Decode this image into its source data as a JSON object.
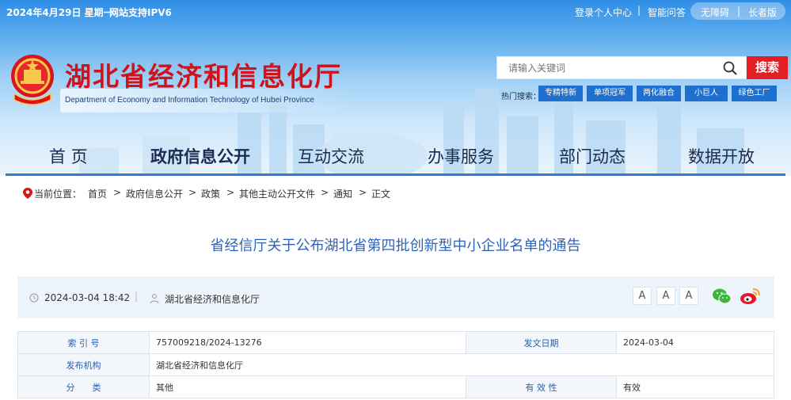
{
  "topbar": {
    "date": "2024年4月29日 星期一",
    "ipv6": "网站支持IPV6",
    "login": "登录个人中心",
    "separator": "|",
    "qa": "智能问答",
    "accessibility": "无障碍",
    "pill_separator": "|",
    "elderly": "长者版"
  },
  "site": {
    "title": "湖北省经济和信息化厅",
    "subtitle_en": "Department of Economy and Information Technology of Hubei Province"
  },
  "search": {
    "placeholder": "请输入关键词",
    "button": "搜索",
    "hot_label": "热门搜索：",
    "hot_tags": [
      "专精特新",
      "单项冠军",
      "两化融合",
      "小巨人",
      "绿色工厂"
    ]
  },
  "nav": {
    "items": [
      "首 页",
      "政府信息公开",
      "互动交流",
      "办事服务",
      "部门动态",
      "数据开放"
    ],
    "active_index": 1
  },
  "breadcrumb": {
    "label": "当前位置：",
    "items": [
      "首页",
      "政府信息公开",
      "政策",
      "其他主动公开文件",
      "通知",
      "正文"
    ],
    "sep": ">"
  },
  "article": {
    "title": "省经信厅关于公布湖北省第四批创新型中小企业名单的通告",
    "datetime": "2024-03-04 18:42",
    "sep": "|",
    "org": "湖北省经济和信息化厅",
    "font_buttons": [
      "A",
      "A",
      "A"
    ]
  },
  "meta": {
    "index_label": "索 引 号",
    "index_value": "757009218/2024-13276",
    "date_label": "发文日期",
    "date_value": "2024-03-04",
    "issuer_label": "发布机构",
    "issuer_value": "湖北省经济和信息化厅",
    "category_label": "分　　类",
    "category_value": "其他",
    "validity_label": "有 效 性",
    "validity_value": "有效"
  },
  "colors": {
    "brand_red": "#e51d24",
    "title_blue": "#2f63b8",
    "nav_text": "#1b2b4d",
    "tag_blue": "#1f6fcf"
  }
}
